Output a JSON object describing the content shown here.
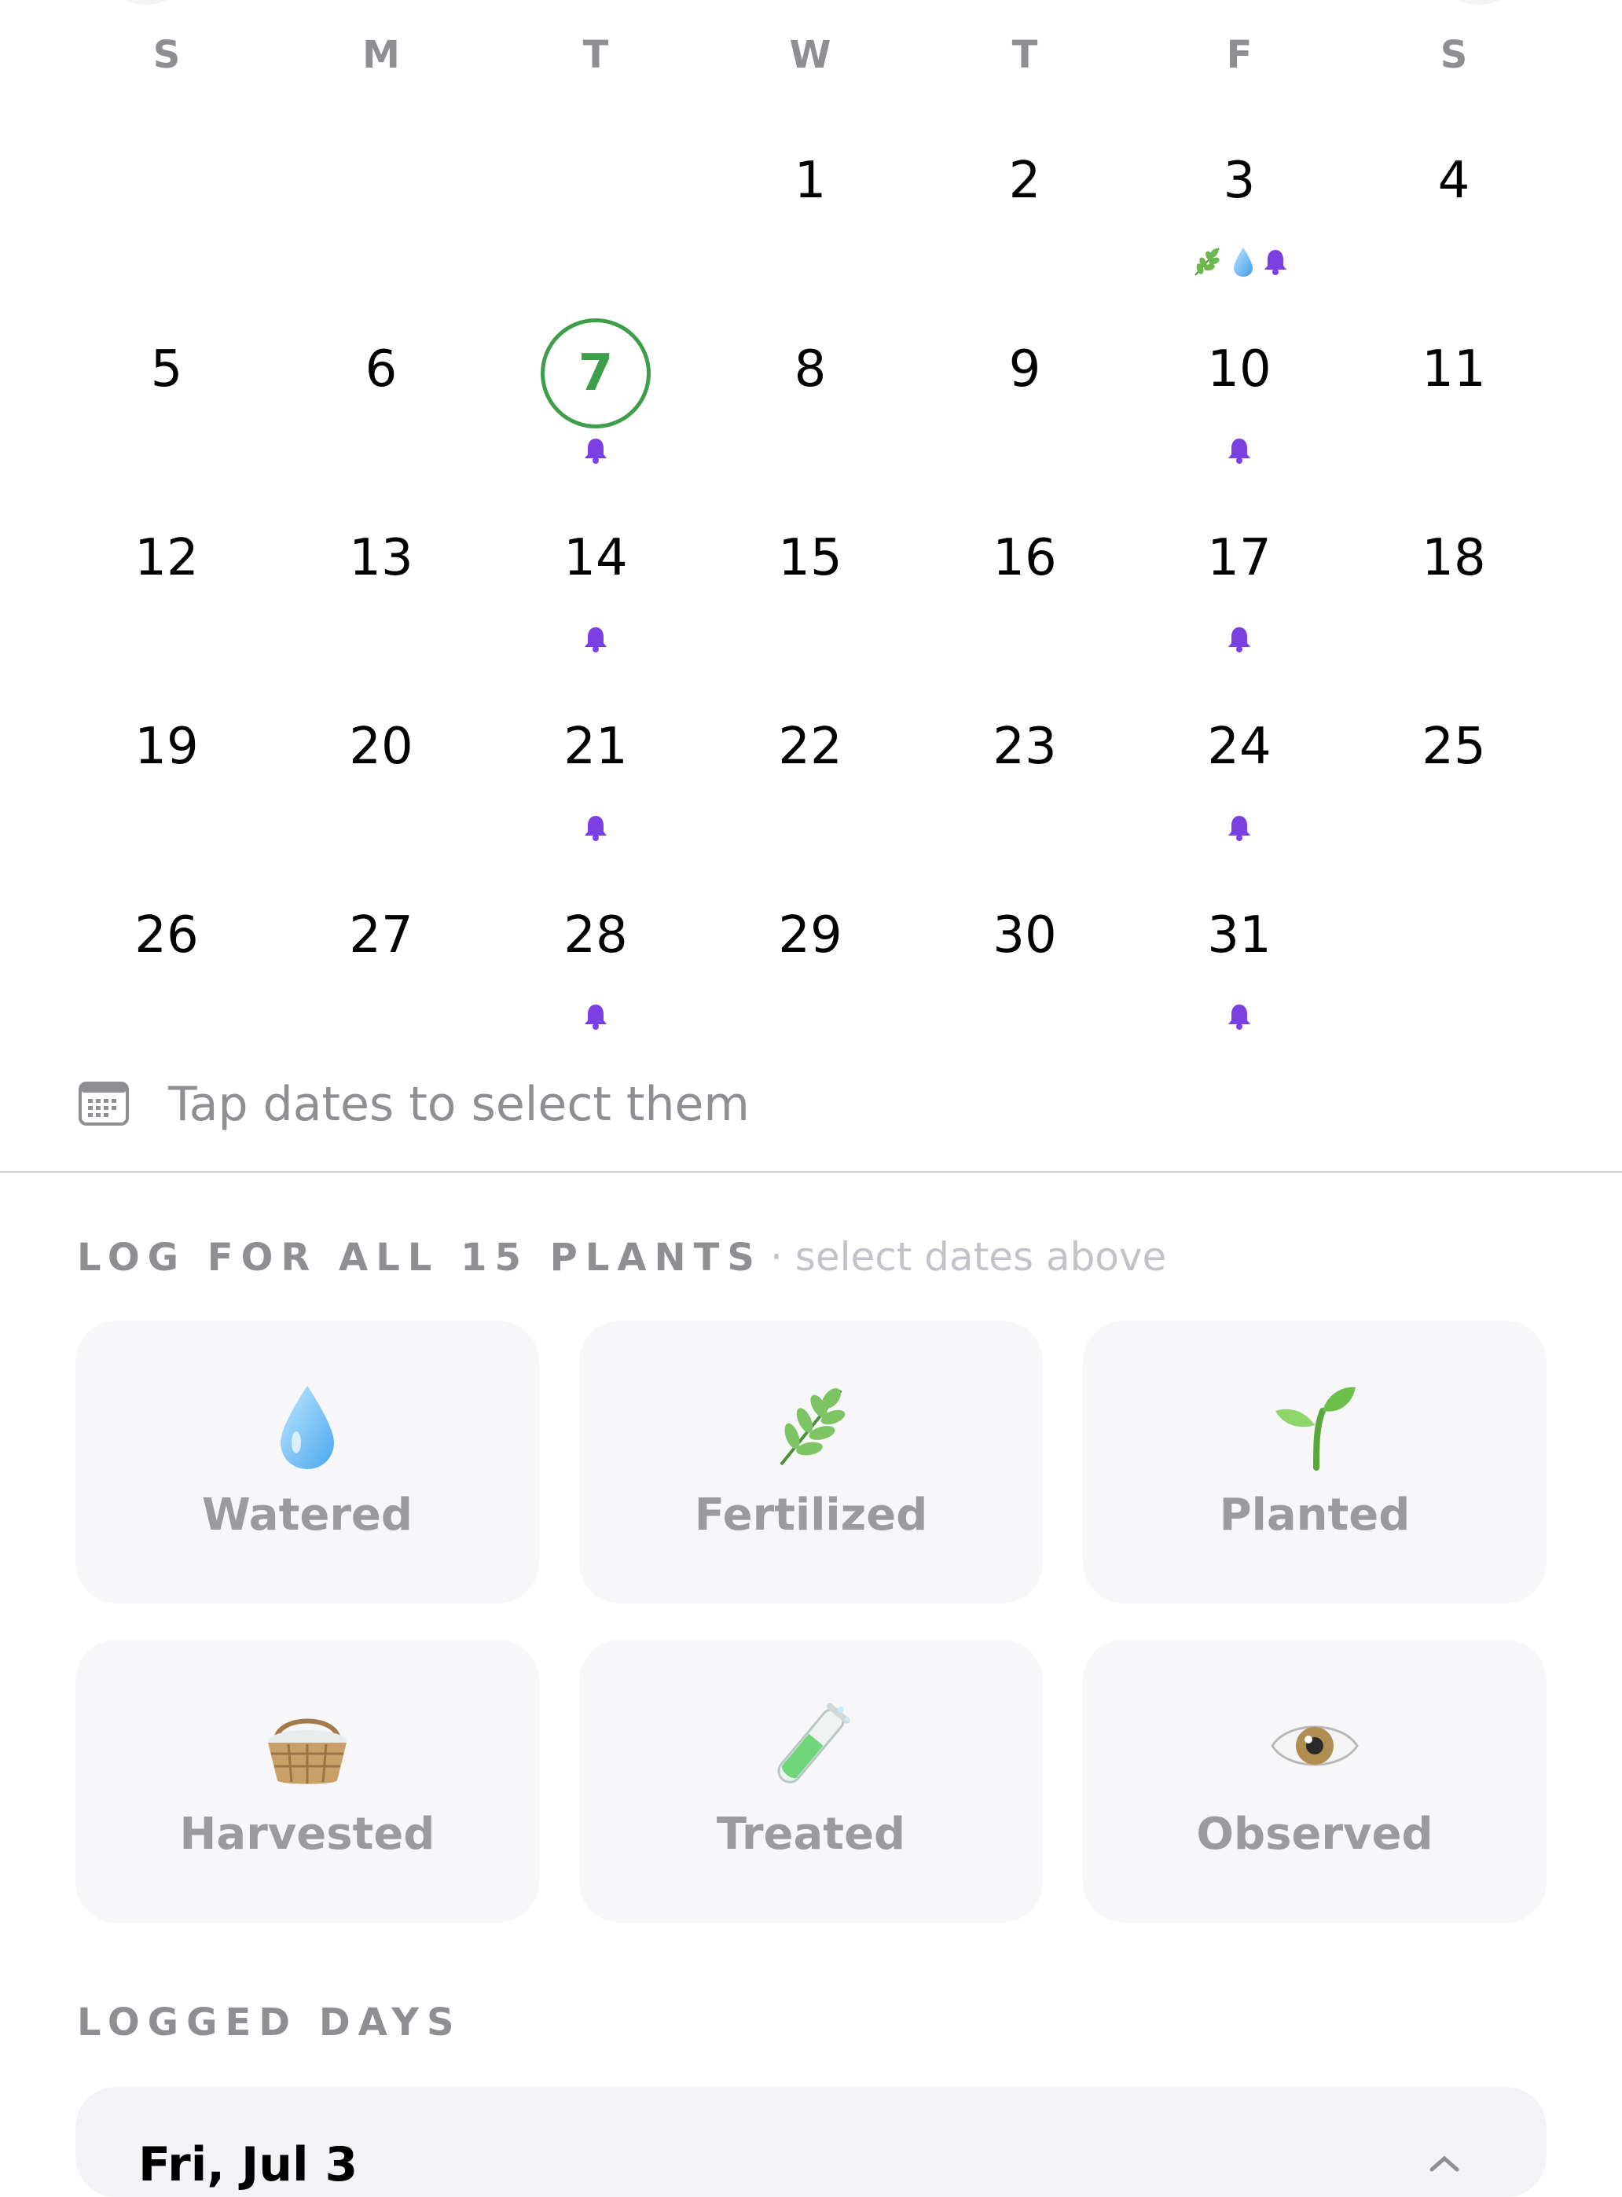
{
  "weekdays": [
    "S",
    "M",
    "T",
    "W",
    "T",
    "F",
    "S"
  ],
  "calendar": {
    "today": "7",
    "days": [
      {
        "num": "1",
        "markers": []
      },
      {
        "num": "2",
        "markers": []
      },
      {
        "num": "3",
        "markers": [
          "herb-icon",
          "water-drop-icon",
          "bell-icon"
        ]
      },
      {
        "num": "4",
        "markers": []
      },
      {
        "num": "5",
        "markers": []
      },
      {
        "num": "6",
        "markers": []
      },
      {
        "num": "7",
        "markers": [
          "bell-icon"
        ]
      },
      {
        "num": "8",
        "markers": []
      },
      {
        "num": "9",
        "markers": []
      },
      {
        "num": "10",
        "markers": [
          "bell-icon"
        ]
      },
      {
        "num": "11",
        "markers": []
      },
      {
        "num": "12",
        "markers": []
      },
      {
        "num": "13",
        "markers": []
      },
      {
        "num": "14",
        "markers": [
          "bell-icon"
        ]
      },
      {
        "num": "15",
        "markers": []
      },
      {
        "num": "16",
        "markers": []
      },
      {
        "num": "17",
        "markers": [
          "bell-icon"
        ]
      },
      {
        "num": "18",
        "markers": []
      },
      {
        "num": "19",
        "markers": []
      },
      {
        "num": "20",
        "markers": []
      },
      {
        "num": "21",
        "markers": [
          "bell-icon"
        ]
      },
      {
        "num": "22",
        "markers": []
      },
      {
        "num": "23",
        "markers": []
      },
      {
        "num": "24",
        "markers": [
          "bell-icon"
        ]
      },
      {
        "num": "25",
        "markers": []
      },
      {
        "num": "26",
        "markers": []
      },
      {
        "num": "27",
        "markers": []
      },
      {
        "num": "28",
        "markers": [
          "bell-icon"
        ]
      },
      {
        "num": "29",
        "markers": []
      },
      {
        "num": "30",
        "markers": []
      },
      {
        "num": "31",
        "markers": [
          "bell-icon"
        ]
      }
    ]
  },
  "hint": {
    "icon": "calendar-icon",
    "text": "Tap dates to select them"
  },
  "log_section": {
    "title": "LOG FOR ALL 15 PLANTS",
    "subtitle": "· select dates above"
  },
  "actions": [
    {
      "label": "Watered",
      "icon": "water-drop-icon"
    },
    {
      "label": "Fertilized",
      "icon": "herb-icon"
    },
    {
      "label": "Planted",
      "icon": "seedling-icon"
    },
    {
      "label": "Harvested",
      "icon": "basket-icon"
    },
    {
      "label": "Treated",
      "icon": "test-tube-icon"
    },
    {
      "label": "Observed",
      "icon": "eye-icon"
    }
  ],
  "logged_days": {
    "title": "LOGGED DAYS",
    "first_date": "Fri, Jul 3"
  },
  "colors": {
    "accent": "#3f9e49",
    "bell": "#7b3fe4",
    "water": "#5ab4f0",
    "muted_text": "#8e8e93"
  }
}
